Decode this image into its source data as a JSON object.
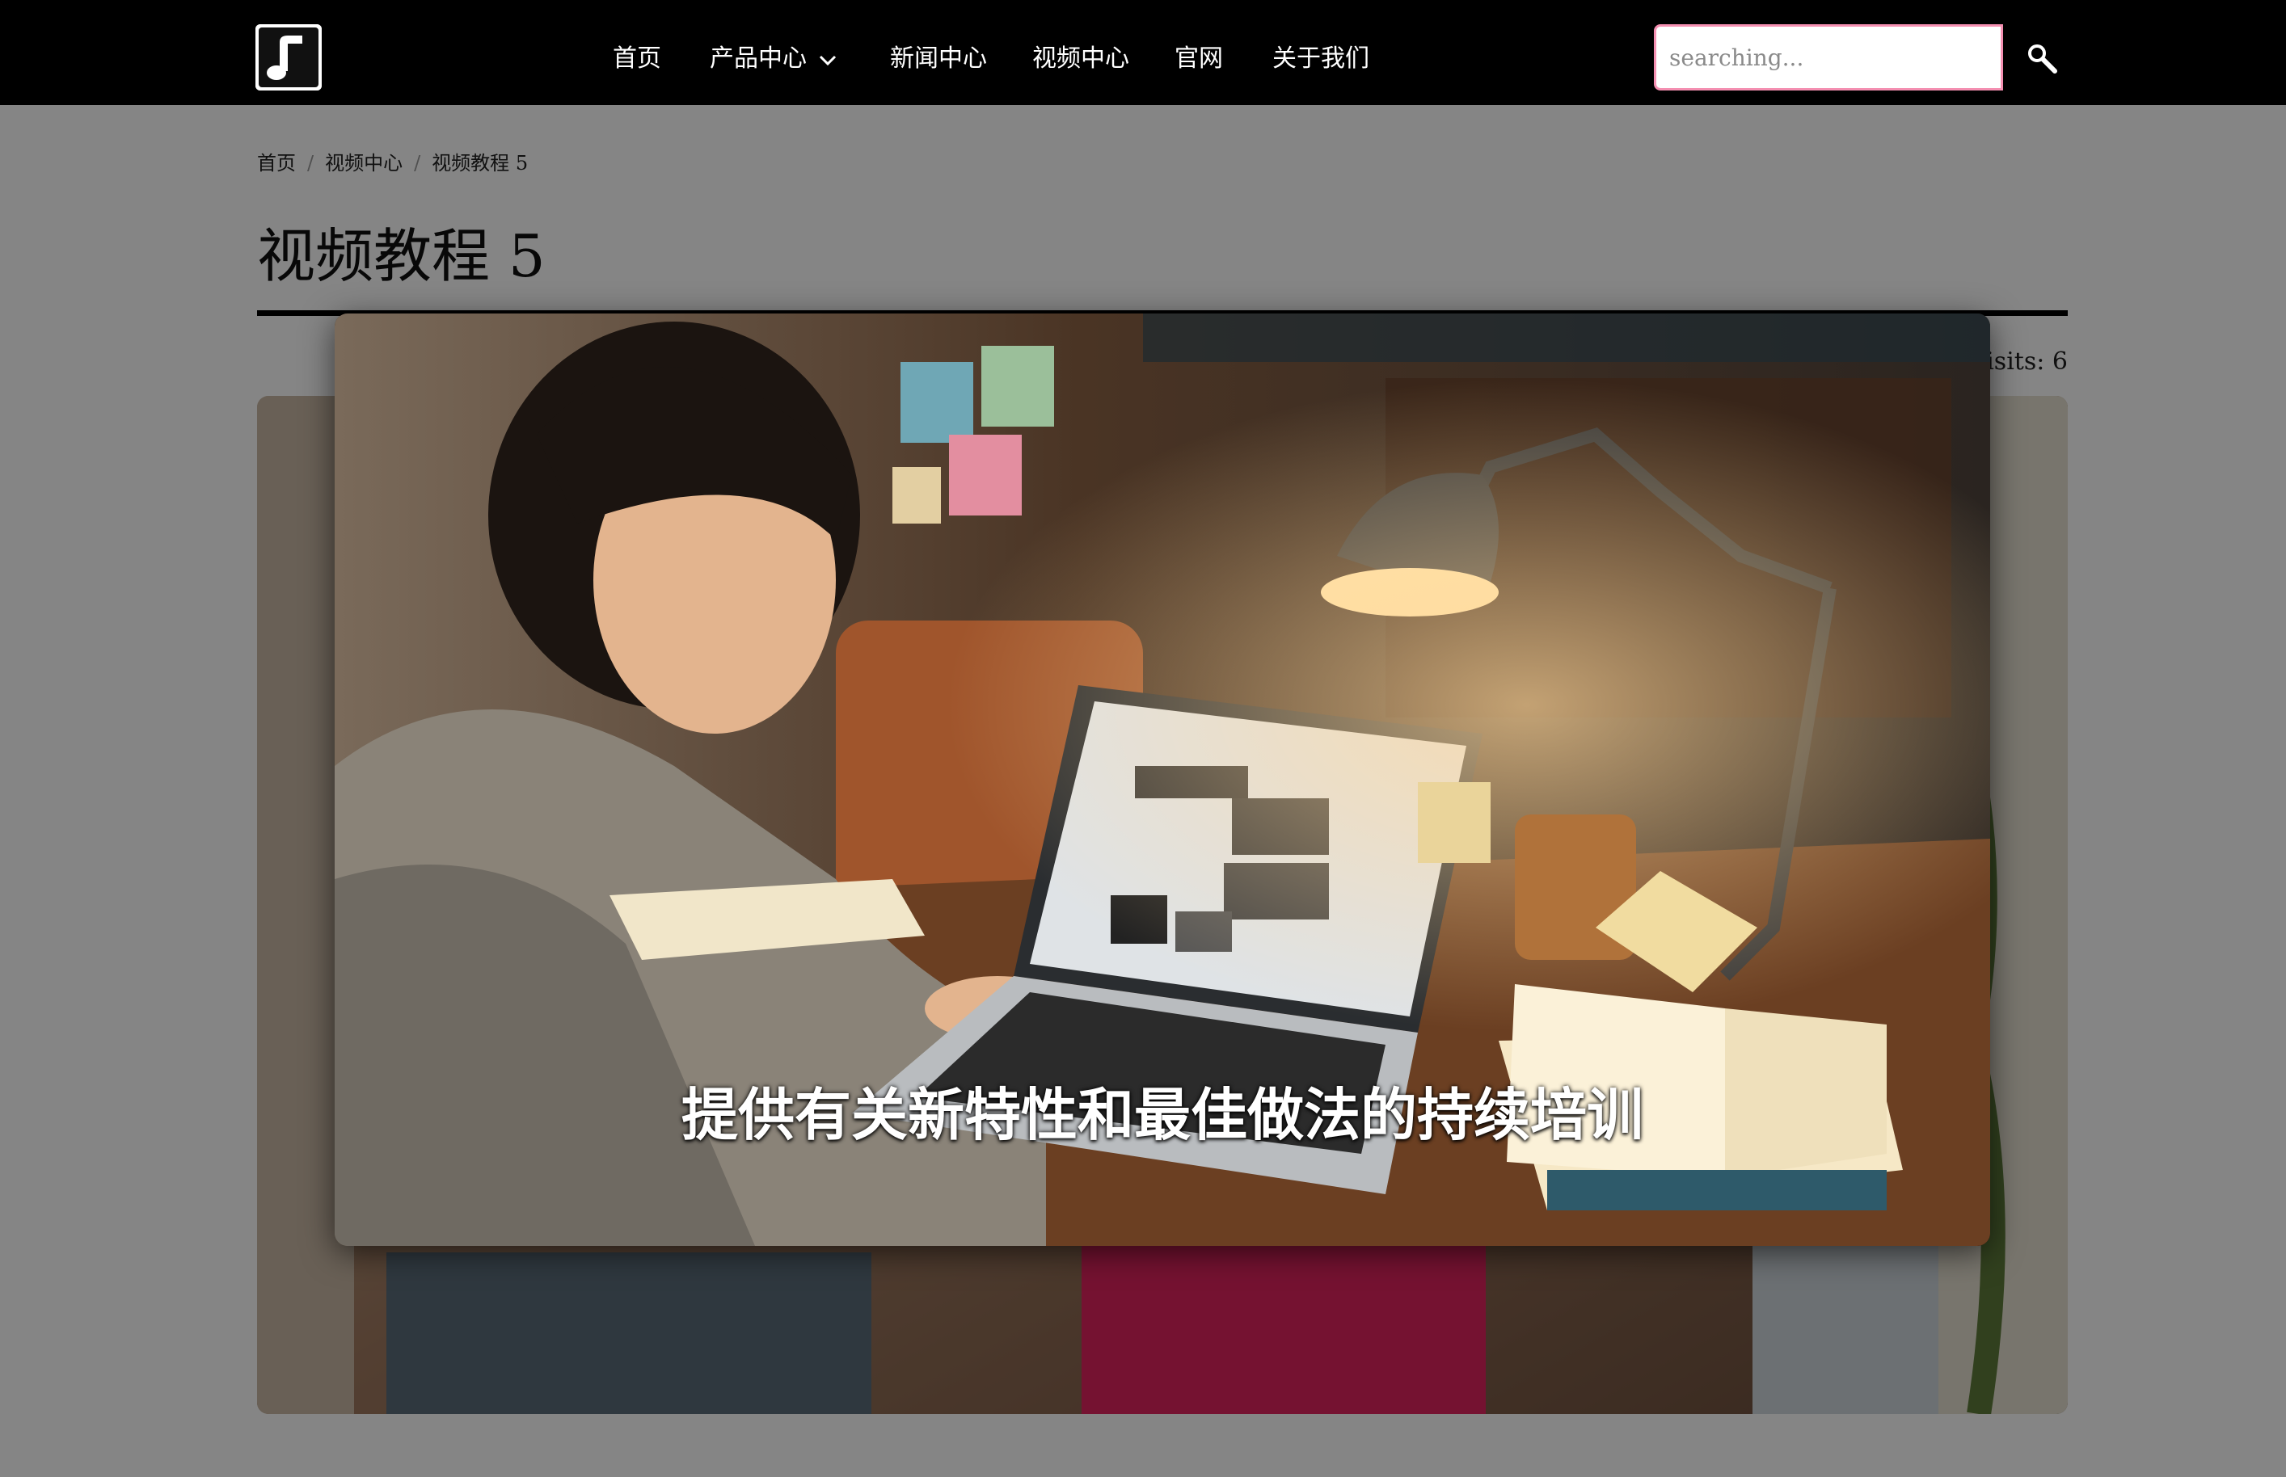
{
  "colors": {
    "topbar_bg": "#000000",
    "search_border": "#f48fb1",
    "page_bg": "#ffffff",
    "overlay": "rgba(0,0,0,0.48)"
  },
  "header": {
    "logo_icon": "music-note-icon",
    "nav": {
      "home": "首页",
      "products": "产品中心",
      "news": "新闻中心",
      "video": "视频中心",
      "official": "官网",
      "about": "关于我们"
    },
    "search": {
      "placeholder": "searching...",
      "value": "",
      "button_icon": "search-icon"
    }
  },
  "breadcrumb": {
    "home": "首页",
    "section": "视频中心",
    "current": "视频教程 5",
    "separator": "/"
  },
  "page": {
    "title": "视频教程 5",
    "visits_label": "isits:",
    "visits_value": "6"
  },
  "video_modal": {
    "subtitle": "提供有关新特性和最佳做法的持续培训"
  }
}
